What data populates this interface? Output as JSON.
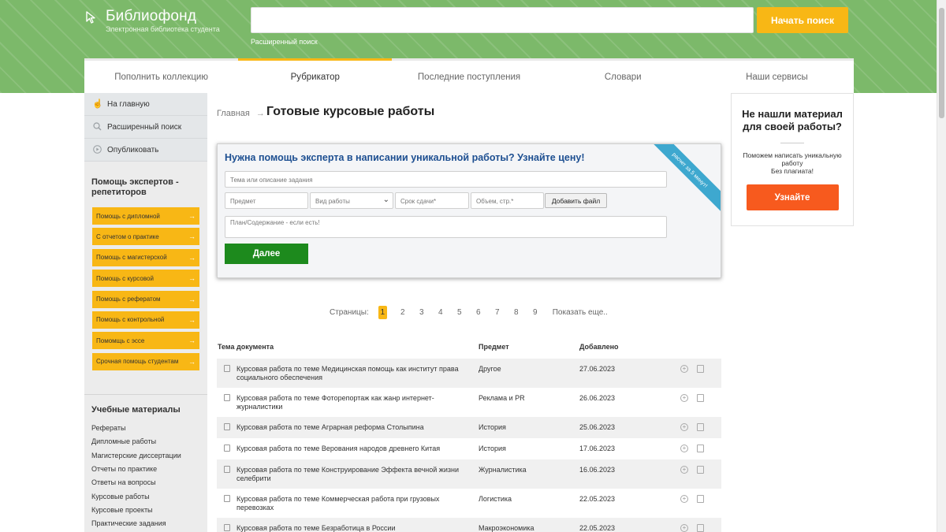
{
  "header": {
    "logo_title": "Библиофонд",
    "logo_subtitle": "Электронная библиотека студента",
    "search_placeholder": "",
    "search_button": "Начать поиск",
    "advanced_search": "Расширенный поиск"
  },
  "tabs": [
    {
      "label": "Пополнить коллекцию",
      "active": false
    },
    {
      "label": "Рубрикатор",
      "active": true
    },
    {
      "label": "Последние поступления",
      "active": false
    },
    {
      "label": "Словари",
      "active": false
    },
    {
      "label": "Наши сервисы",
      "active": false
    }
  ],
  "sidebar": {
    "links": [
      {
        "label": "На главную",
        "icon": "hand-pointer-icon"
      },
      {
        "label": "Расширенный поиск",
        "icon": "search-icon"
      },
      {
        "label": "Опубликовать",
        "icon": "play-circle-icon"
      }
    ],
    "help_title": "Помощь экспертов - репетиторов",
    "help_items": [
      "Помощь с дипломной",
      "С отчетом о практике",
      "Помощь с магистерской",
      "Помощь с курсовой",
      "Помощь с рефератом",
      "Помощь с контрольной",
      "Помомщь с эссе",
      "Срочная помощь студентам"
    ],
    "materials_title": "Учебные материалы",
    "materials": [
      "Рефераты",
      "Дипломные работы",
      "Магистерские диссертации",
      "Отчеты по практике",
      "Ответы на вопросы",
      "Курсовые работы",
      "Курсовые проекты",
      "Практические задания"
    ]
  },
  "breadcrumb": {
    "home": "Главная",
    "separator": "→"
  },
  "page_title": "Готовые курсовые работы",
  "order_form": {
    "heading": "Нужна помощь эксперта в написании уникальной работы? Узнайте цену!",
    "topic_placeholder": "Тема или описание задания",
    "subject_placeholder": "Предмет",
    "work_type": "Вид работы",
    "deadline_placeholder": "Срок сдачи*",
    "volume_placeholder": "Объем, стр.*",
    "attach_button": "Добавить файл",
    "plan_placeholder": "План/Содержание - если есть!",
    "next_button": "Далее",
    "ribbon": "расчет за 5 минут!"
  },
  "pagination": {
    "label": "Страницы:",
    "current": "1",
    "pages": [
      "2",
      "3",
      "4",
      "5",
      "6",
      "7",
      "8",
      "9"
    ],
    "more": "Показать еще.."
  },
  "table": {
    "headers": {
      "doc": "Тема документа",
      "subject": "Предмет",
      "added": "Добавлено"
    },
    "rows": [
      {
        "title": "Курсовая работа по теме Медицинская помощь как институт права социального обеспечения",
        "subject": "Другое",
        "date": "27.06.2023"
      },
      {
        "title": "Курсовая работа по теме Фоторепортаж как жанр интернет-журналистики",
        "subject": "Реклама и PR",
        "date": "26.06.2023"
      },
      {
        "title": "Курсовая работа по теме Аграрная реформа Столыпина",
        "subject": "История",
        "date": "25.06.2023"
      },
      {
        "title": "Курсовая работа по теме Верования народов древнего Китая",
        "subject": "История",
        "date": "17.06.2023"
      },
      {
        "title": "Курсовая работа по теме Конструирование Эффекта вечной жизни селебрити",
        "subject": "Журналистика",
        "date": "16.06.2023"
      },
      {
        "title": "Курсовая работа по теме Коммерческая работа при грузовых перевозках",
        "subject": "Логистика",
        "date": "22.05.2023"
      },
      {
        "title": "Курсовая работа по теме Безработица в России",
        "subject": "Макроэкономика",
        "date": "22.05.2023"
      }
    ]
  },
  "promo": {
    "heading": "Не нашли материал для своей работы?",
    "text": "Поможем написать уникальную работу",
    "text2": "Без плагиата!",
    "button": "Узнайте"
  },
  "colors": {
    "header_green": "#7cb96a",
    "accent_yellow": "#f8b715",
    "cta_orange": "#f75a1e",
    "next_green": "#1d8a1d",
    "form_heading_blue": "#1d4f91"
  }
}
